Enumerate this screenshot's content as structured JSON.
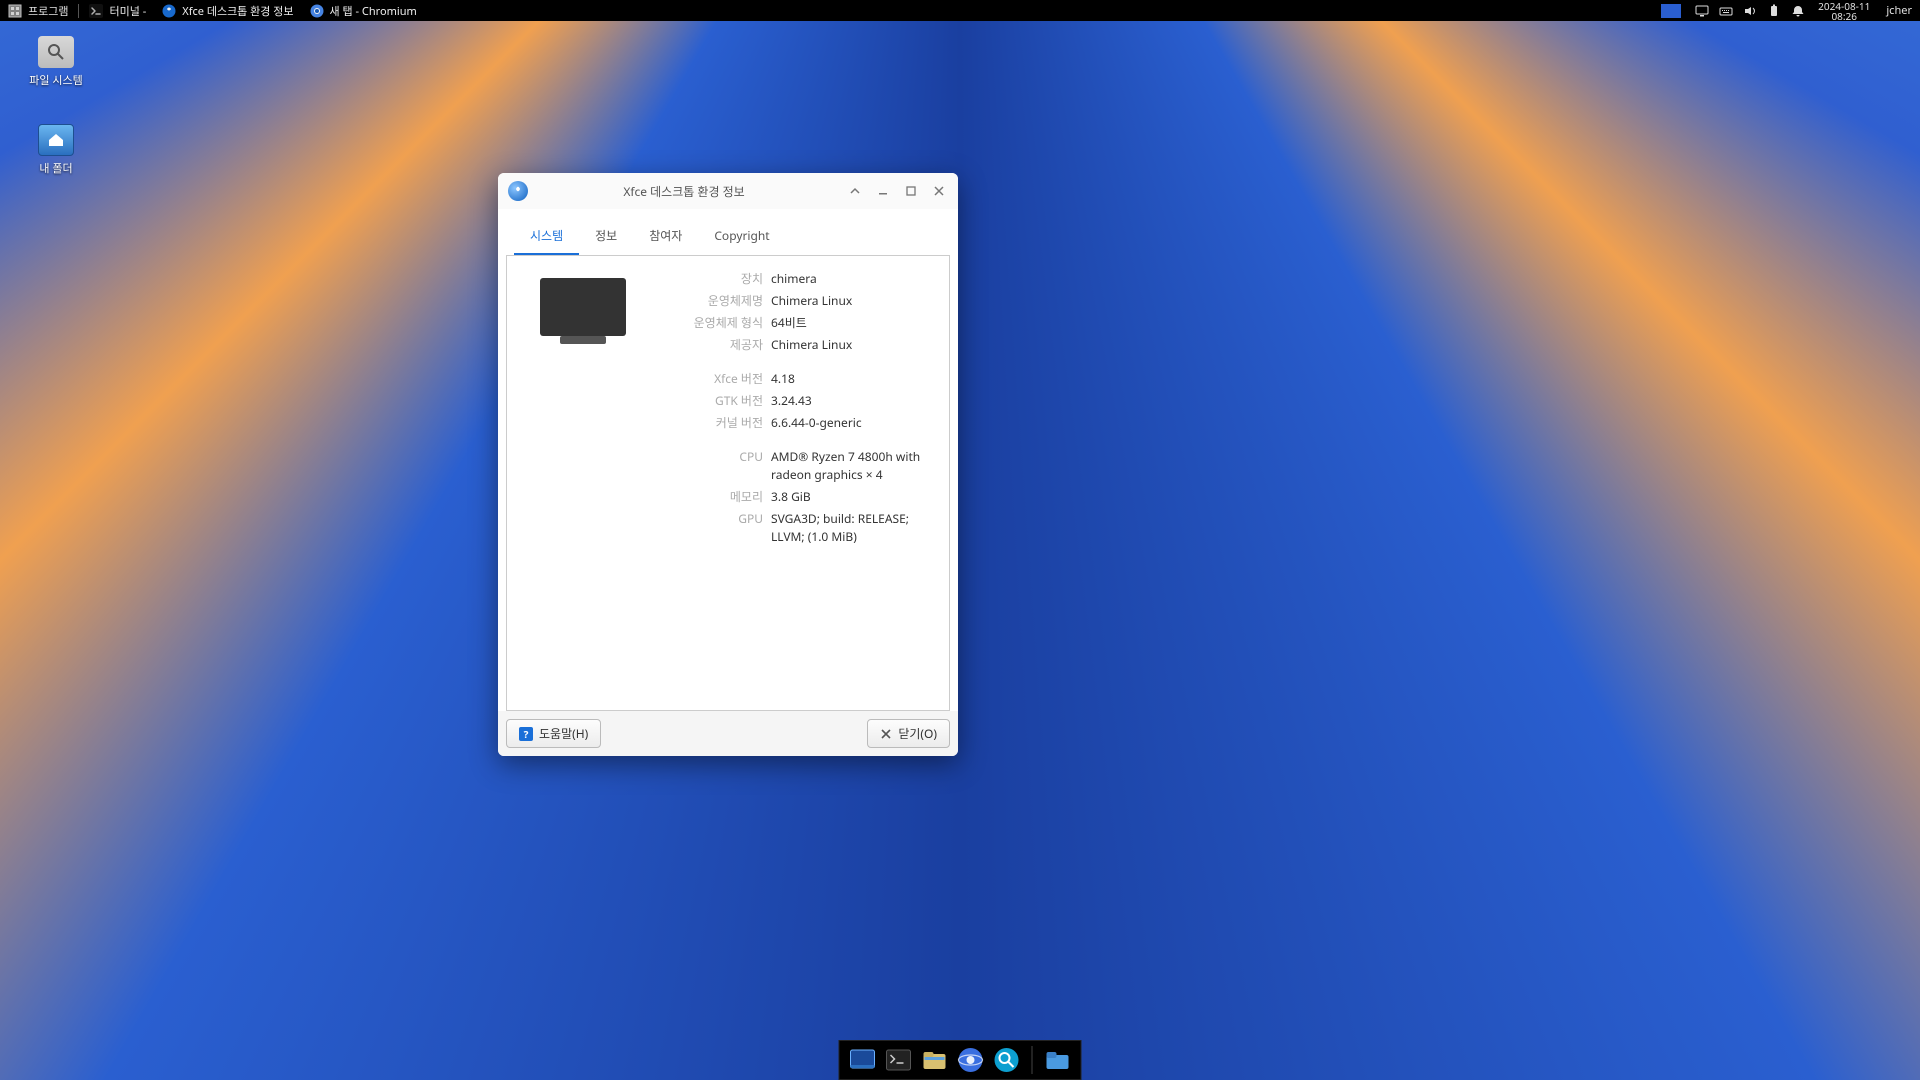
{
  "panel": {
    "apps_label": "프로그램",
    "tasks": [
      {
        "label": "터미널 -",
        "icon": "terminal"
      },
      {
        "label": "Xfce 데스크톱 환경 정보",
        "icon": "xfce-about",
        "active": true
      },
      {
        "label": "새 탭 - Chromium",
        "icon": "chromium"
      }
    ],
    "clock_date": "2024-08-11",
    "clock_time": "08:26",
    "user": "jcher"
  },
  "desktop": {
    "filesystem_label": "파일 시스템",
    "home_label": "내 폴더"
  },
  "dialog": {
    "title": "Xfce 데스크톱 환경 정보",
    "tabs": [
      "시스템",
      "정보",
      "참여자",
      "Copyright"
    ],
    "rows": {
      "device_lbl": "장치",
      "device_val": "chimera",
      "osname_lbl": "운영체제명",
      "osname_val": "Chimera Linux",
      "ostype_lbl": "운영체제 형식",
      "ostype_val": "64비트",
      "vendor_lbl": "제공자",
      "vendor_val": "Chimera Linux",
      "xfcever_lbl": "Xfce 버전",
      "xfcever_val": "4.18",
      "gtkver_lbl": "GTK 버전",
      "gtkver_val": "3.24.43",
      "kernel_lbl": "커널 버전",
      "kernel_val": "6.6.44-0-generic",
      "cpu_lbl": "CPU",
      "cpu_val": "AMD® Ryzen 7 4800h with radeon graphics × 4",
      "mem_lbl": "메모리",
      "mem_val": "3.8 GiB",
      "gpu_lbl": "GPU",
      "gpu_val": "SVGA3D; build: RELEASE; LLVM; (1.0 MiB)"
    },
    "help": "도움말(H)",
    "close": "닫기(O)"
  }
}
